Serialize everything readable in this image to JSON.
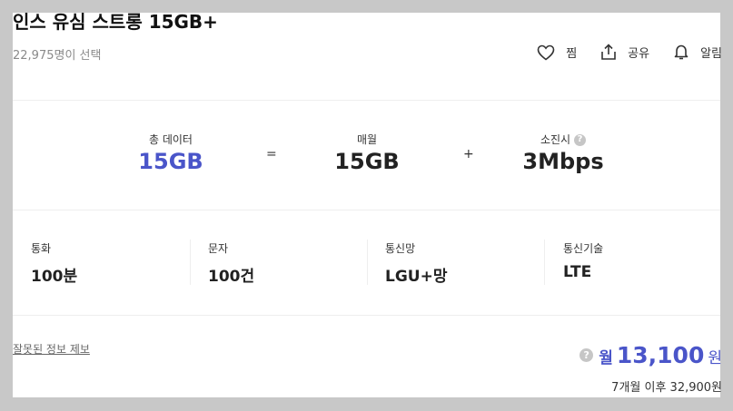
{
  "plan": {
    "title": "인스 유심 스트롱 15GB+",
    "subtitle": "22,975명이 선택"
  },
  "actions": [
    {
      "label": "찜",
      "icon": "heart-icon"
    },
    {
      "label": "공유",
      "icon": "share-icon"
    },
    {
      "label": "알림",
      "icon": "bell-icon"
    }
  ],
  "data_equation": {
    "total": {
      "label": "총 데이터",
      "value": "15GB"
    },
    "equals": "=",
    "monthly": {
      "label": "매월",
      "value": "15GB"
    },
    "plus": "+",
    "throttle": {
      "label": "소진시",
      "value": "3Mbps",
      "help": "?"
    }
  },
  "specs": [
    {
      "label": "통화",
      "value": "100분"
    },
    {
      "label": "문자",
      "value": "100건"
    },
    {
      "label": "통신망",
      "value": "LGU+망"
    },
    {
      "label": "통신기술",
      "value": "LTE"
    }
  ],
  "footer": {
    "report_link": "잘못된 정보 제보",
    "price_help": "?",
    "price_prefix": "월",
    "price_amount": "13,100",
    "price_unit": "원",
    "after_price": "7개월 이후 32,900원"
  },
  "colors": {
    "accent": "#4a55c9",
    "background": "#ffffff",
    "frame": "#c8c8c8"
  }
}
